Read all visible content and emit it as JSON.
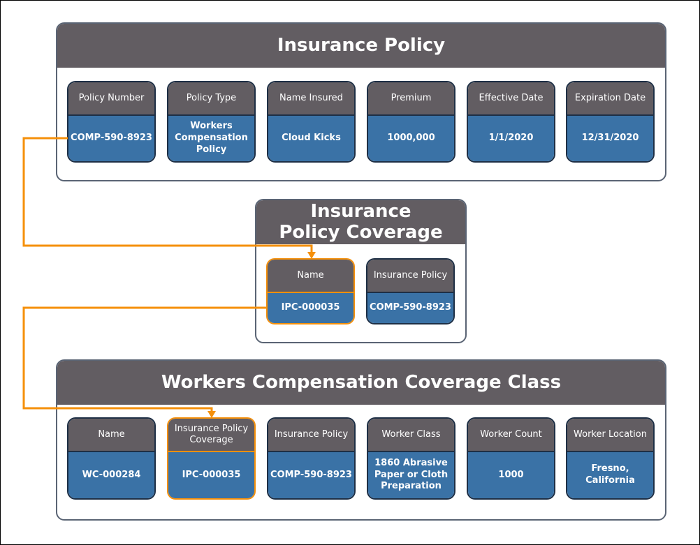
{
  "colors": {
    "header": "#625d62",
    "value": "#3a72a6",
    "connector": "#f5900b",
    "border": "#1e2f45"
  },
  "insurance_policy": {
    "title": "Insurance Policy",
    "fields": [
      {
        "label": "Policy Number",
        "value": "COMP-590-8923"
      },
      {
        "label": "Policy Type",
        "value": "Workers Compensation Policy"
      },
      {
        "label": "Name Insured",
        "value": "Cloud Kicks"
      },
      {
        "label": "Premium",
        "value": "1000,000"
      },
      {
        "label": "Effective Date",
        "value": "1/1/2020"
      },
      {
        "label": "Expiration Date",
        "value": "12/31/2020"
      }
    ]
  },
  "coverage": {
    "title": "Insurance Policy Coverage",
    "fields": [
      {
        "label": "Name",
        "value": "IPC-000035"
      },
      {
        "label": "Insurance Policy",
        "value": "COMP-590-8923"
      }
    ]
  },
  "coverage_class": {
    "title": "Workers Compensation Coverage Class",
    "fields": [
      {
        "label": "Name",
        "value": "WC-000284"
      },
      {
        "label": "Insurance Policy Coverage",
        "value": "IPC-000035"
      },
      {
        "label": "Insurance Policy",
        "value": "COMP-590-8923"
      },
      {
        "label": "Worker Class",
        "value": "1860 Abrasive Paper or Cloth Preparation"
      },
      {
        "label": "Worker Count",
        "value": "1000"
      },
      {
        "label": "Worker Location",
        "value": "Fresno, California"
      }
    ]
  }
}
